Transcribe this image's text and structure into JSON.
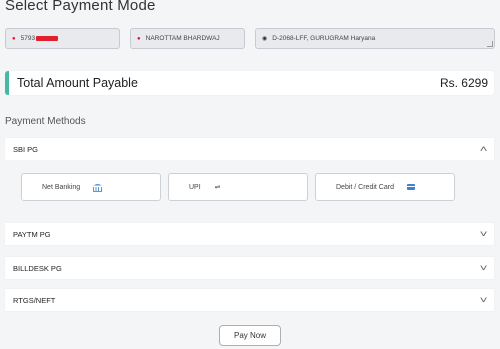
{
  "page": {
    "title": "Select Payment Mode"
  },
  "customer": {
    "phone": "5793",
    "name": "NAROTTAM BHARDWAJ",
    "address": "D-2068-LFF, GURUGRAM  Haryana"
  },
  "total": {
    "label": "Total Amount Payable",
    "amount": "Rs. 6299"
  },
  "payment": {
    "section_title": "Payment Methods",
    "gateways": [
      {
        "label": "SBI PG",
        "expanded": true
      },
      {
        "label": "PAYTM PG",
        "expanded": false
      },
      {
        "label": "BILLDESK PG",
        "expanded": false
      },
      {
        "label": "RTGS/NEFT",
        "expanded": false
      }
    ],
    "options": [
      {
        "label": "Net Banking",
        "icon": "bank-icon"
      },
      {
        "label": "UPI",
        "icon": "upi-icon"
      },
      {
        "label": "Debit / Credit Card",
        "icon": "credit-card-icon"
      }
    ]
  },
  "actions": {
    "pay_label": "Pay Now"
  },
  "colors": {
    "accent": "#48b8a6",
    "pin": "#e0112b",
    "redaction": "#e21f2f",
    "card_icon": "#3f7fd1"
  }
}
